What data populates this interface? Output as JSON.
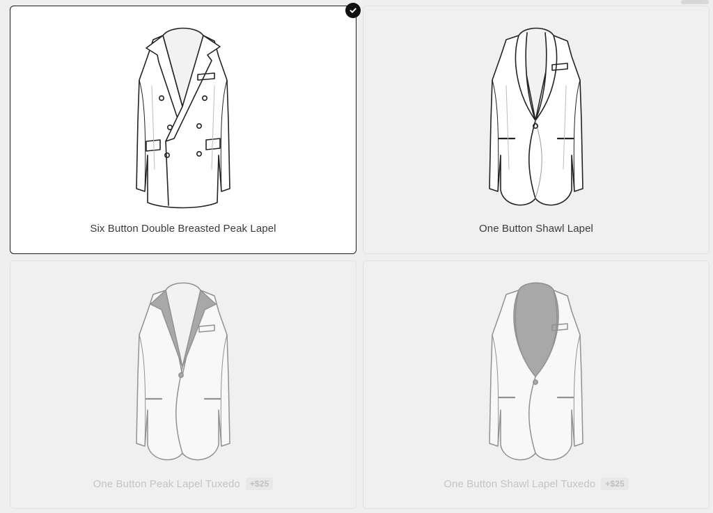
{
  "options": [
    {
      "label": "Six Button Double Breasted Peak Lapel",
      "price": "",
      "state": "selected"
    },
    {
      "label": "One Button Shawl Lapel",
      "price": "",
      "state": "available"
    },
    {
      "label": "One Button Peak Lapel Tuxedo",
      "price": "+$25",
      "state": "disabled"
    },
    {
      "label": "One Button Shawl Lapel Tuxedo",
      "price": "+$25",
      "state": "disabled"
    }
  ],
  "icons": {
    "selected_marker": "checkmark-icon"
  },
  "colors": {
    "selected_border": "#1a1a1a",
    "check_bg": "#111111",
    "card_bg": "#f0f0f0",
    "lapel_fill": "#a8a8a8"
  }
}
